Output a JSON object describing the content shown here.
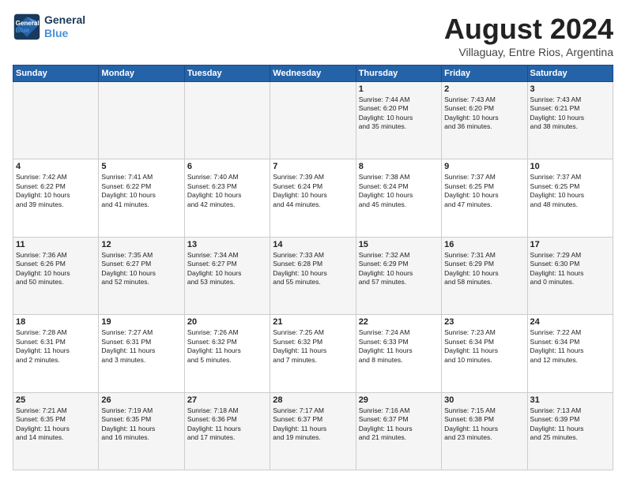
{
  "logo": {
    "line1": "General",
    "line2": "Blue"
  },
  "title": "August 2024",
  "subtitle": "Villaguay, Entre Rios, Argentina",
  "days_header": [
    "Sunday",
    "Monday",
    "Tuesday",
    "Wednesday",
    "Thursday",
    "Friday",
    "Saturday"
  ],
  "weeks": [
    [
      {
        "day": "",
        "text": ""
      },
      {
        "day": "",
        "text": ""
      },
      {
        "day": "",
        "text": ""
      },
      {
        "day": "",
        "text": ""
      },
      {
        "day": "1",
        "text": "Sunrise: 7:44 AM\nSunset: 6:20 PM\nDaylight: 10 hours\nand 35 minutes."
      },
      {
        "day": "2",
        "text": "Sunrise: 7:43 AM\nSunset: 6:20 PM\nDaylight: 10 hours\nand 36 minutes."
      },
      {
        "day": "3",
        "text": "Sunrise: 7:43 AM\nSunset: 6:21 PM\nDaylight: 10 hours\nand 38 minutes."
      }
    ],
    [
      {
        "day": "4",
        "text": "Sunrise: 7:42 AM\nSunset: 6:22 PM\nDaylight: 10 hours\nand 39 minutes."
      },
      {
        "day": "5",
        "text": "Sunrise: 7:41 AM\nSunset: 6:22 PM\nDaylight: 10 hours\nand 41 minutes."
      },
      {
        "day": "6",
        "text": "Sunrise: 7:40 AM\nSunset: 6:23 PM\nDaylight: 10 hours\nand 42 minutes."
      },
      {
        "day": "7",
        "text": "Sunrise: 7:39 AM\nSunset: 6:24 PM\nDaylight: 10 hours\nand 44 minutes."
      },
      {
        "day": "8",
        "text": "Sunrise: 7:38 AM\nSunset: 6:24 PM\nDaylight: 10 hours\nand 45 minutes."
      },
      {
        "day": "9",
        "text": "Sunrise: 7:37 AM\nSunset: 6:25 PM\nDaylight: 10 hours\nand 47 minutes."
      },
      {
        "day": "10",
        "text": "Sunrise: 7:37 AM\nSunset: 6:25 PM\nDaylight: 10 hours\nand 48 minutes."
      }
    ],
    [
      {
        "day": "11",
        "text": "Sunrise: 7:36 AM\nSunset: 6:26 PM\nDaylight: 10 hours\nand 50 minutes."
      },
      {
        "day": "12",
        "text": "Sunrise: 7:35 AM\nSunset: 6:27 PM\nDaylight: 10 hours\nand 52 minutes."
      },
      {
        "day": "13",
        "text": "Sunrise: 7:34 AM\nSunset: 6:27 PM\nDaylight: 10 hours\nand 53 minutes."
      },
      {
        "day": "14",
        "text": "Sunrise: 7:33 AM\nSunset: 6:28 PM\nDaylight: 10 hours\nand 55 minutes."
      },
      {
        "day": "15",
        "text": "Sunrise: 7:32 AM\nSunset: 6:29 PM\nDaylight: 10 hours\nand 57 minutes."
      },
      {
        "day": "16",
        "text": "Sunrise: 7:31 AM\nSunset: 6:29 PM\nDaylight: 10 hours\nand 58 minutes."
      },
      {
        "day": "17",
        "text": "Sunrise: 7:29 AM\nSunset: 6:30 PM\nDaylight: 11 hours\nand 0 minutes."
      }
    ],
    [
      {
        "day": "18",
        "text": "Sunrise: 7:28 AM\nSunset: 6:31 PM\nDaylight: 11 hours\nand 2 minutes."
      },
      {
        "day": "19",
        "text": "Sunrise: 7:27 AM\nSunset: 6:31 PM\nDaylight: 11 hours\nand 3 minutes."
      },
      {
        "day": "20",
        "text": "Sunrise: 7:26 AM\nSunset: 6:32 PM\nDaylight: 11 hours\nand 5 minutes."
      },
      {
        "day": "21",
        "text": "Sunrise: 7:25 AM\nSunset: 6:32 PM\nDaylight: 11 hours\nand 7 minutes."
      },
      {
        "day": "22",
        "text": "Sunrise: 7:24 AM\nSunset: 6:33 PM\nDaylight: 11 hours\nand 8 minutes."
      },
      {
        "day": "23",
        "text": "Sunrise: 7:23 AM\nSunset: 6:34 PM\nDaylight: 11 hours\nand 10 minutes."
      },
      {
        "day": "24",
        "text": "Sunrise: 7:22 AM\nSunset: 6:34 PM\nDaylight: 11 hours\nand 12 minutes."
      }
    ],
    [
      {
        "day": "25",
        "text": "Sunrise: 7:21 AM\nSunset: 6:35 PM\nDaylight: 11 hours\nand 14 minutes."
      },
      {
        "day": "26",
        "text": "Sunrise: 7:19 AM\nSunset: 6:35 PM\nDaylight: 11 hours\nand 16 minutes."
      },
      {
        "day": "27",
        "text": "Sunrise: 7:18 AM\nSunset: 6:36 PM\nDaylight: 11 hours\nand 17 minutes."
      },
      {
        "day": "28",
        "text": "Sunrise: 7:17 AM\nSunset: 6:37 PM\nDaylight: 11 hours\nand 19 minutes."
      },
      {
        "day": "29",
        "text": "Sunrise: 7:16 AM\nSunset: 6:37 PM\nDaylight: 11 hours\nand 21 minutes."
      },
      {
        "day": "30",
        "text": "Sunrise: 7:15 AM\nSunset: 6:38 PM\nDaylight: 11 hours\nand 23 minutes."
      },
      {
        "day": "31",
        "text": "Sunrise: 7:13 AM\nSunset: 6:39 PM\nDaylight: 11 hours\nand 25 minutes."
      }
    ]
  ]
}
